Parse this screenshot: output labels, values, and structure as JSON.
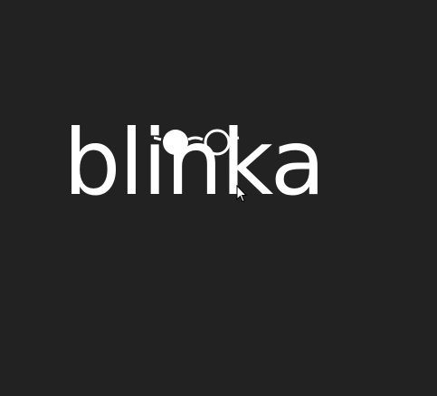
{
  "app": {
    "logo_text": "blinka",
    "icons": {
      "logo_glasses": "glasses-icon",
      "pointer": "mouse-pointer-icon"
    }
  },
  "colors": {
    "background": "#222222",
    "logo": "#ffffff",
    "cursor_fill": "#ffffff",
    "cursor_outline": "#000000"
  }
}
